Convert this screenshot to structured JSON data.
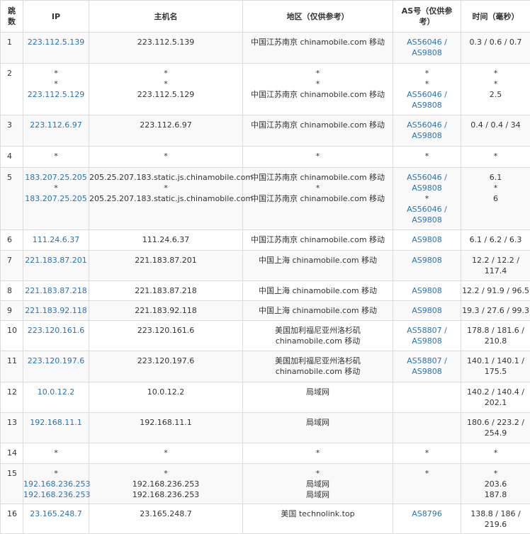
{
  "header": {
    "hop": "跳数",
    "ip": "IP",
    "host": "主机名",
    "region": "地区（仅供参考）",
    "as": "AS号（仅供参考）",
    "time": "时间（毫秒）"
  },
  "colors": {
    "link": "#2a72b8",
    "text": "#333333",
    "border": "#dcdcdc",
    "stripe": "#f9f9f9"
  },
  "rows": [
    {
      "hop": "1",
      "ip": [
        "223.112.5.139"
      ],
      "host": [
        "223.112.5.139"
      ],
      "region": [
        "中国江苏南京 chinamobile.com 移动"
      ],
      "as": [
        "AS56046 /",
        "AS9808"
      ],
      "time": [
        "0.3 / 0.6 / 0.7"
      ]
    },
    {
      "hop": "2",
      "ip": [
        "*",
        "*",
        "223.112.5.129"
      ],
      "host": [
        "*",
        "*",
        "223.112.5.129"
      ],
      "region": [
        "*",
        "*",
        "中国江苏南京 chinamobile.com 移动"
      ],
      "as": [
        "*",
        "*",
        "AS56046 /",
        "AS9808"
      ],
      "time": [
        "*",
        "*",
        "2.5"
      ]
    },
    {
      "hop": "3",
      "ip": [
        "223.112.6.97"
      ],
      "host": [
        "223.112.6.97"
      ],
      "region": [
        "中国江苏南京 chinamobile.com 移动"
      ],
      "as": [
        "AS56046 /",
        "AS9808"
      ],
      "time": [
        "0.4 / 0.4 / 34"
      ]
    },
    {
      "hop": "4",
      "ip": [
        "*"
      ],
      "host": [
        "*"
      ],
      "region": [
        "*"
      ],
      "as": [
        "*"
      ],
      "time": [
        "*"
      ]
    },
    {
      "hop": "5",
      "ip": [
        "183.207.25.205",
        "*",
        "183.207.25.205"
      ],
      "host": [
        "205.25.207.183.static.js.chinamobile.com",
        "*",
        "205.25.207.183.static.js.chinamobile.com"
      ],
      "region": [
        "中国江苏南京 chinamobile.com 移动",
        "*",
        "中国江苏南京 chinamobile.com 移动"
      ],
      "as": [
        "AS56046 /",
        "AS9808",
        "*",
        "AS56046 /",
        "AS9808"
      ],
      "time": [
        "6.1",
        "*",
        "6"
      ]
    },
    {
      "hop": "6",
      "ip": [
        "111.24.6.37"
      ],
      "host": [
        "111.24.6.37"
      ],
      "region": [
        "中国江苏南京 chinamobile.com 移动"
      ],
      "as": [
        "AS9808"
      ],
      "time": [
        "6.1 / 6.2 / 6.3"
      ]
    },
    {
      "hop": "7",
      "ip": [
        "221.183.87.201"
      ],
      "host": [
        "221.183.87.201"
      ],
      "region": [
        "中国上海 chinamobile.com 移动"
      ],
      "as": [
        "AS9808"
      ],
      "time": [
        "12.2 / 12.2 /",
        "117.4"
      ]
    },
    {
      "hop": "8",
      "ip": [
        "221.183.87.218"
      ],
      "host": [
        "221.183.87.218"
      ],
      "region": [
        "中国上海 chinamobile.com 移动"
      ],
      "as": [
        "AS9808"
      ],
      "time": [
        "12.2 / 91.9 / 96.5"
      ]
    },
    {
      "hop": "9",
      "ip": [
        "221.183.92.118"
      ],
      "host": [
        "221.183.92.118"
      ],
      "region": [
        "中国上海 chinamobile.com 移动"
      ],
      "as": [
        "AS9808"
      ],
      "time": [
        "19.3 / 27.6 / 99.3"
      ]
    },
    {
      "hop": "10",
      "ip": [
        "223.120.161.6"
      ],
      "host": [
        "223.120.161.6"
      ],
      "region": [
        "美国加利福尼亚州洛杉矶",
        "chinamobile.com 移动"
      ],
      "as": [
        "AS58807 /",
        "AS9808"
      ],
      "time": [
        "178.8 / 181.6 /",
        "210.8"
      ]
    },
    {
      "hop": "11",
      "ip": [
        "223.120.197.6"
      ],
      "host": [
        "223.120.197.6"
      ],
      "region": [
        "美国加利福尼亚州洛杉矶",
        "chinamobile.com 移动"
      ],
      "as": [
        "AS58807 /",
        "AS9808"
      ],
      "time": [
        "140.1 / 140.1 /",
        "175.5"
      ]
    },
    {
      "hop": "12",
      "ip": [
        "10.0.12.2"
      ],
      "host": [
        "10.0.12.2"
      ],
      "region": [
        "局域网"
      ],
      "as": [],
      "time": [
        "140.2 / 140.4 /",
        "202.1"
      ]
    },
    {
      "hop": "13",
      "ip": [
        "192.168.11.1"
      ],
      "host": [
        "192.168.11.1"
      ],
      "region": [
        "局域网"
      ],
      "as": [],
      "time": [
        "180.6 / 223.2 /",
        "254.9"
      ]
    },
    {
      "hop": "14",
      "ip": [
        "*"
      ],
      "host": [
        "*"
      ],
      "region": [
        "*"
      ],
      "as": [
        "*"
      ],
      "time": [
        "*"
      ]
    },
    {
      "hop": "15",
      "ip": [
        "*",
        "192.168.236.253",
        "192.168.236.253"
      ],
      "host": [
        "*",
        "192.168.236.253",
        "192.168.236.253"
      ],
      "region": [
        "*",
        "局域网",
        "局域网"
      ],
      "as": [
        "*"
      ],
      "time": [
        "*",
        "203.6",
        "187.8"
      ]
    },
    {
      "hop": "16",
      "ip": [
        "23.165.248.7"
      ],
      "host": [
        "23.165.248.7"
      ],
      "region": [
        "美国 technolink.top"
      ],
      "as": [
        "AS8796"
      ],
      "time": [
        "138.8 / 186 /",
        "219.6"
      ]
    }
  ]
}
